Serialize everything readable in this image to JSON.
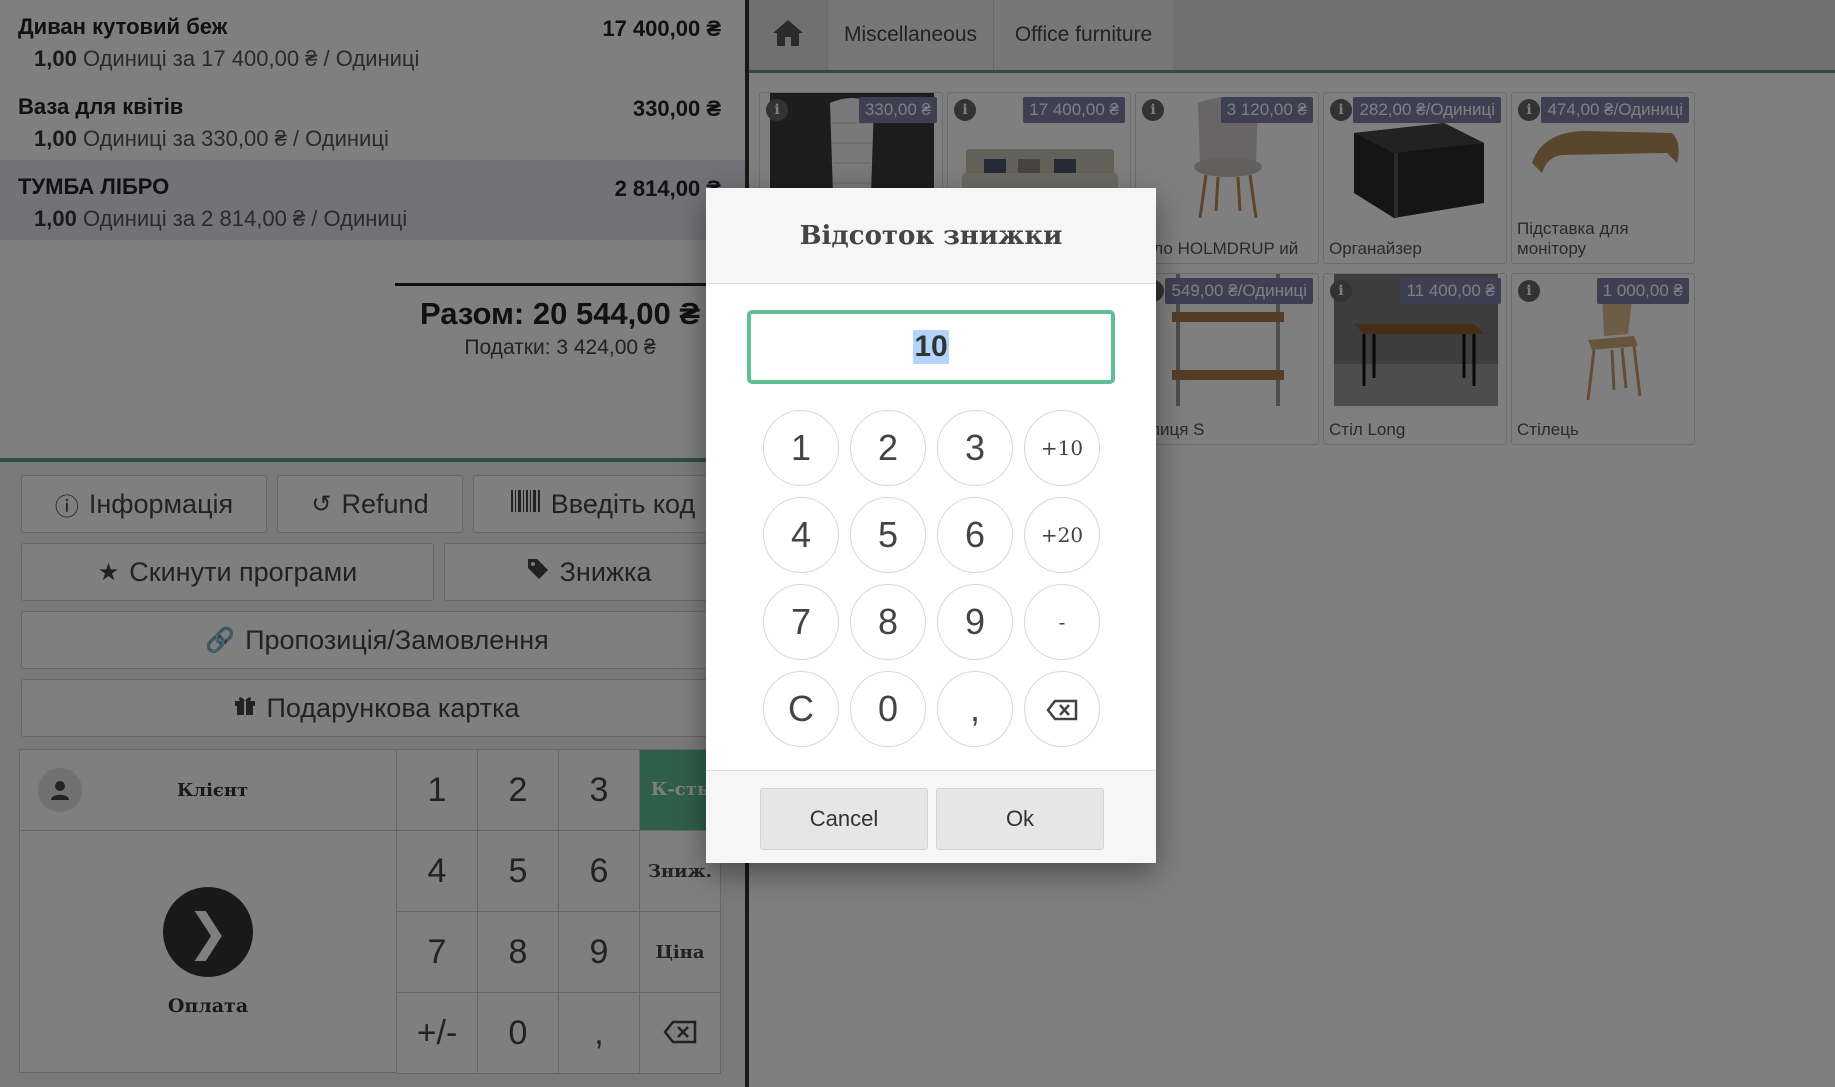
{
  "order": {
    "lines": [
      {
        "name": "Диван кутовий беж",
        "price": "17 400,00 ₴",
        "qty": "1,00",
        "info": "Одиниці за 17 400,00 ₴ / Одиниці"
      },
      {
        "name": "Ваза для квітів",
        "price": "330,00 ₴",
        "qty": "1,00",
        "info": "Одиниці за 330,00 ₴ / Одиниці"
      },
      {
        "name": "ТУМБА ЛІБРО",
        "price": "2 814,00 ₴",
        "qty": "1,00",
        "info": "Одиниці за 2 814,00 ₴ / Одиниці"
      }
    ],
    "total": "Разом: 20 544,00 ₴",
    "taxes": "Податки: 3 424,00 ₴"
  },
  "control_buttons": {
    "info": "Інформація",
    "refund": "Refund",
    "enter_code": "Введіть код",
    "reset_programs": "Скинути програми",
    "discount": "Знижка",
    "quotation": "Пропозиція/Замовлення",
    "gift_card": "Подарункова картка"
  },
  "keypad": {
    "customer": "Клієнт",
    "payment": "Оплата",
    "keys": [
      "1",
      "2",
      "3",
      "4",
      "5",
      "6",
      "7",
      "8",
      "9",
      "+/-",
      "0",
      ","
    ],
    "modes": {
      "qty": "К-сть",
      "disc": "Зниж.",
      "price": "Ціна"
    }
  },
  "categories": [
    "Miscellaneous",
    "Office furniture"
  ],
  "products": [
    {
      "name": "",
      "price": "330,00 ₴"
    },
    {
      "name": "",
      "price": "17 400,00 ₴"
    },
    {
      "name": "ісло HOLMDRUP ий",
      "price": "3 120,00 ₴"
    },
    {
      "name": "Органайзер",
      "price": "282,00 ₴/Одиниці"
    },
    {
      "name": "Підставка для монітору",
      "price": "474,00 ₴/Одиниці"
    },
    {
      "name": "олиця S",
      "price": "549,00 ₴/Одиниці"
    },
    {
      "name": "Стіл Long",
      "price": "11 400,00 ₴"
    },
    {
      "name": "Стілець",
      "price": "1 000,00 ₴"
    }
  ],
  "dialog": {
    "title": "Відсоток знижки",
    "value": "10",
    "keys": [
      "1",
      "2",
      "3",
      "+10",
      "4",
      "5",
      "6",
      "+20",
      "7",
      "8",
      "9",
      "-",
      "C",
      "0",
      ","
    ],
    "cancel": "Cancel",
    "ok": "Ok"
  },
  "colors": {
    "accent": "#5fbf95",
    "price_tag": "#7e7ea8",
    "separator": "#5a9e80"
  }
}
